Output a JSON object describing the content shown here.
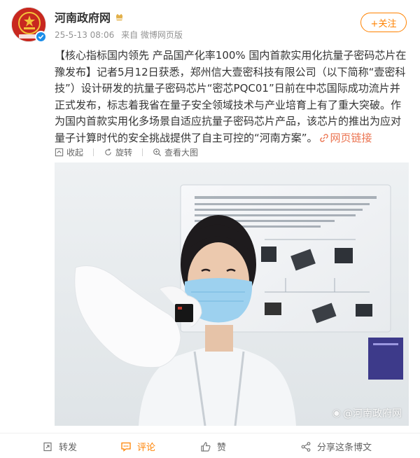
{
  "header": {
    "username": "河南政府网",
    "timestamp": "25-5-13 08:06",
    "source": "来自 微博网页版",
    "follow_label": "+关注"
  },
  "post": {
    "title_part": "【核心指标国内领先 产品国产化率100% 国内首款实用化抗量子密码芯片在豫发布】",
    "body": "记者5月12日获悉，郑州信大壹密科技有限公司（以下简称“壹密科技”）设计研发的抗量子密码芯片“密芯PQC01”日前在中芯国际成功流片并正式发布，标志着我省在量子安全领域技术与产业培育上有了重大突破。作为国内首款实用化多场景自适应抗量子密码芯片产品，该芯片的推出为应对量子计算时代的安全挑战提供了自主可控的“河南方案”。",
    "link_label": "网页链接"
  },
  "image_tools": {
    "collapse": "收起",
    "rotate": "旋转",
    "view_large": "查看大图"
  },
  "photo": {
    "watermark": "@河南政府网"
  },
  "actions": {
    "repost": "转发",
    "comment": "评论",
    "like": "赞",
    "share": "分享这条博文"
  },
  "colors": {
    "accent": "#ff8200",
    "link": "#eb7350",
    "verified": "#1c8ee9",
    "avatar_red": "#c8281f"
  }
}
